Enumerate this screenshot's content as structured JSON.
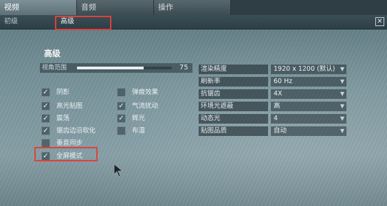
{
  "tabs": [
    {
      "label": "视频",
      "active": true
    },
    {
      "label": "音频",
      "active": false
    },
    {
      "label": "操作",
      "active": false
    }
  ],
  "subtabs": [
    {
      "label": "初级",
      "active": false
    },
    {
      "label": "高级",
      "active": true
    }
  ],
  "close_icon": "close-icon",
  "section_title": "高级",
  "view_range": {
    "label": "视角范围",
    "value": "75",
    "fill_fraction": 0.7
  },
  "checkboxes_left": [
    {
      "label": "阴影",
      "checked": true
    },
    {
      "label": "高光贴图",
      "checked": true
    },
    {
      "label": "震荡",
      "checked": true
    },
    {
      "label": "锯齿边沿软化",
      "checked": true
    },
    {
      "label": "垂直同步",
      "checked": false
    },
    {
      "label": "全屏模式",
      "checked": true
    }
  ],
  "checkboxes_mid": [
    {
      "label": "弹痕效果",
      "checked": false
    },
    {
      "label": "气流扰动",
      "checked": true
    },
    {
      "label": "辉光",
      "checked": true
    },
    {
      "label": "布温",
      "checked": false
    }
  ],
  "settings": [
    {
      "label": "渲染精度",
      "value": "1920 x 1200 (默认)"
    },
    {
      "label": "刷新率",
      "value": "60 Hz"
    },
    {
      "label": "抗锯齿",
      "value": "4X"
    },
    {
      "label": "环境光遮蔽",
      "value": "高"
    },
    {
      "label": "动态光",
      "value": "4"
    },
    {
      "label": "贴图品质",
      "value": "自动"
    }
  ],
  "colors": {
    "highlight_box": "#e0413a",
    "active_tab": "#7d9098"
  }
}
